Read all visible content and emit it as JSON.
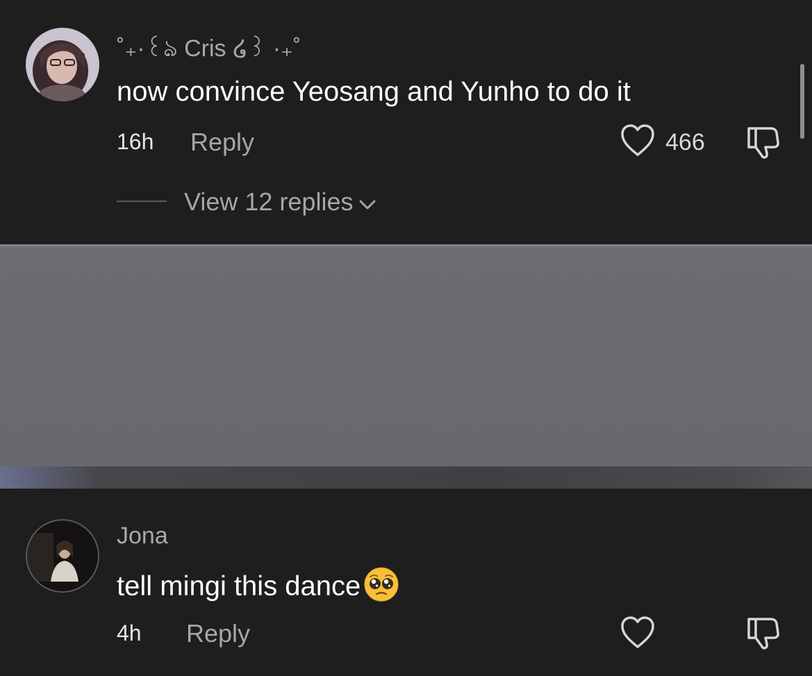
{
  "comments": [
    {
      "username": "˚₊·꒰ঌ Cris ໒꒱ ·₊˚",
      "text": "now convince Yeosang and Yunho to do it",
      "time": "16h",
      "reply_label": "Reply",
      "likes": "466",
      "view_replies_label": "View 12 replies"
    },
    {
      "username": "Jona",
      "text": "tell mingi this dance",
      "emoji": "pleading-face-emoji",
      "time": "4h",
      "reply_label": "Reply",
      "likes": ""
    }
  ],
  "icons": [
    "heart-icon",
    "thumbs-down-icon",
    "chevron-down-icon",
    "pleading-face-emoji"
  ],
  "colors": {
    "background": "#1e1e1f",
    "secondary_text": "#a6a6aa",
    "blurred_panel": "#6a6a6e"
  }
}
